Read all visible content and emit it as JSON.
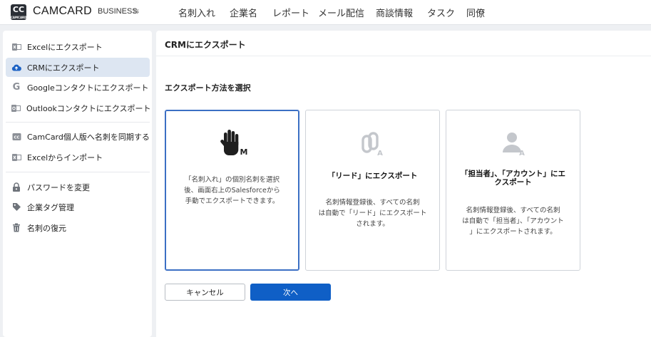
{
  "header": {
    "logo_text": "CC",
    "logo_subtext": "CAMCARD",
    "brand": "CAMCARD",
    "edition": "BUSINESS",
    "edition_switch_icon": "swap-icon",
    "nav": [
      "名刺入れ",
      "企業名",
      "レポート",
      "メール配信",
      "商談情報",
      "タスク",
      "同僚"
    ]
  },
  "sidebar": {
    "items": [
      {
        "label": "Excelにエクスポート",
        "icon": "excel-icon"
      },
      {
        "label": "CRMにエクスポート",
        "icon": "cloud-upload-icon",
        "active": true
      },
      {
        "label": "Googleコンタクトにエクスポート",
        "icon": "google-icon"
      },
      {
        "label": "Outlookコンタクトにエクスポート",
        "icon": "outlook-icon"
      },
      {
        "label": "CamCard個人版へ名刺を同期する",
        "icon": "camcard-icon"
      },
      {
        "label": "Excelからインポート",
        "icon": "excel-icon"
      },
      {
        "label": "パスワードを変更",
        "icon": "lock-icon"
      },
      {
        "label": "企業タグ管理",
        "icon": "tag-icon"
      },
      {
        "label": "名刺の復元",
        "icon": "trash-icon"
      }
    ]
  },
  "main": {
    "title": "CRMにエクスポート",
    "section_title": "エクスポート方法を選択",
    "cards": [
      {
        "heading": "",
        "icon_letter": "M",
        "desc": [
          "「名刺入れ」の個別名刺を選択",
          "後、画面右上のSalesforceから",
          "手動でエクスポートできます。"
        ],
        "selected": true
      },
      {
        "heading": [
          "「リード」にエクスポート"
        ],
        "icon_letter": "A",
        "desc": [
          "名刺情報登録後、すべての名刺",
          "は自動で「リード」にエクスポート",
          "されます。"
        ]
      },
      {
        "heading": [
          "「担当者」、「アカウント」にエ",
          "クスポート"
        ],
        "icon_letter": "A",
        "desc": [
          "名刺情報登録後、すべての名刺",
          "は自動で「担当者」、「アカウント",
          "」にエクスポートされます。"
        ]
      }
    ],
    "cancel_label": "キャンセル",
    "next_label": "次へ"
  },
  "colors": {
    "accent": "#0f5fc6",
    "active_bg": "#dde6f2",
    "selected_border": "#3b6fc4"
  }
}
